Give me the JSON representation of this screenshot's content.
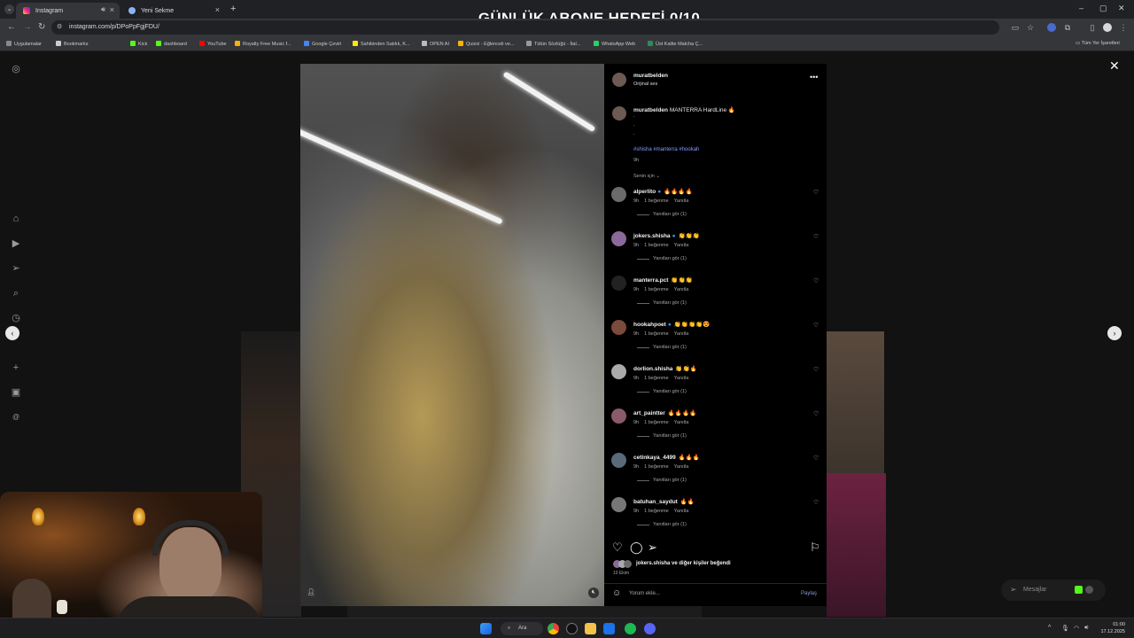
{
  "stream_overlay": {
    "title": "GÜNLÜK ABONE HEDEFİ 0/10"
  },
  "browser": {
    "tabs": [
      {
        "label": "Instagram",
        "active": true
      },
      {
        "label": "Yeni Sekme",
        "active": false
      }
    ],
    "new_tab_glyph": "+",
    "url": "instagram.com/p/DPoPpFgjFDU/",
    "bookmarks": [
      {
        "label": "Uygulamalar",
        "color": "#888888"
      },
      {
        "label": "Bookmarks",
        "color": "#cccccc"
      },
      {
        "label": "Kick",
        "color": "#53fc18"
      },
      {
        "label": "dashboard",
        "color": "#53fc18"
      },
      {
        "label": "YouTube",
        "color": "#ff0000"
      },
      {
        "label": "Royalty Free Music f...",
        "color": "#f4b400"
      },
      {
        "label": "Google Çeviri",
        "color": "#4285f4"
      },
      {
        "label": "Sahibinden Satılık, K...",
        "color": "#ffe800"
      },
      {
        "label": "OPEN AI",
        "color": "#bbbbbb"
      },
      {
        "label": "Quizxi - Eğlenceli ve...",
        "color": "#f4b400"
      },
      {
        "label": "Tütün Sözlüğü - İtal...",
        "color": "#999999"
      },
      {
        "label": "WhatsApp Web",
        "color": "#25d366"
      },
      {
        "label": "Üst Kalite Matcha Ç...",
        "color": "#2e8b57"
      }
    ],
    "all_bookmarks": "Tüm Yer İşaretleri"
  },
  "post": {
    "author": "muratbelden",
    "audio": "Orijinal ses",
    "caption_user": "muratbelden",
    "caption_text": "MANTERRA HardLine 🔥",
    "caption_dots": [
      ".",
      ".",
      "."
    ],
    "hashtags": "#shisha #manterra #hookah",
    "caption_time": "9h",
    "filter_label": "Senin için",
    "comments": [
      {
        "user": "alperlito",
        "verified": true,
        "text": "🔥🔥🔥🔥",
        "time": "9h",
        "likes": "1 beğenme",
        "reply": "Yanıtla",
        "view_replies": "Yanıtları gör (1)",
        "avatar_color": "#6b6b6b"
      },
      {
        "user": "jokers.shisha",
        "verified": true,
        "text": "👏👏👏",
        "time": "9h",
        "likes": "1 beğenme",
        "reply": "Yanıtla",
        "view_replies": "Yanıtları gör (1)",
        "avatar_color": "#8a6a9a"
      },
      {
        "user": "manterra.pct",
        "verified": false,
        "text": "👏👏👏",
        "time": "9h",
        "likes": "1 beğenme",
        "reply": "Yanıtla",
        "view_replies": "Yanıtları gör (1)",
        "avatar_color": "#222222"
      },
      {
        "user": "hookahpoet",
        "verified": true,
        "text": "👏👏👏👏😍",
        "time": "9h",
        "likes": "1 beğenme",
        "reply": "Yanıtla",
        "view_replies": "Yanıtları gör (1)",
        "avatar_color": "#7a4a3a"
      },
      {
        "user": "dorlion.shisha",
        "verified": false,
        "text": "👏👏🔥",
        "time": "9h",
        "likes": "1 beğenme",
        "reply": "Yanıtla",
        "view_replies": "Yanıtları gör (1)",
        "avatar_color": "#aaaaaa"
      },
      {
        "user": "art_paintter",
        "verified": false,
        "text": "🔥🔥🔥🔥",
        "time": "9h",
        "likes": "1 beğenme",
        "reply": "Yanıtla",
        "view_replies": "Yanıtları gör (1)",
        "avatar_color": "#8a5a6a"
      },
      {
        "user": "cetinkaya_4499",
        "verified": false,
        "text": "🔥🔥🔥",
        "time": "9h",
        "likes": "1 beğenme",
        "reply": "Yanıtla",
        "view_replies": "Yanıtları gör (1)",
        "avatar_color": "#5a6a7a"
      },
      {
        "user": "batuhan_saydut",
        "verified": false,
        "text": "🔥🔥",
        "time": "9h",
        "likes": "1 beğenme",
        "reply": "Yanıtla",
        "view_replies": "Yanıtları gör (1)",
        "avatar_color": "#777777"
      }
    ],
    "liked_by": "jokers.shisha ve diğer kişiler beğendi",
    "date": "10 Ekim",
    "comment_placeholder": "Yorum ekle...",
    "share_label": "Paylaş"
  },
  "messages_pill": {
    "label": "Mesajlar"
  },
  "taskbar": {
    "search_label": "Ara",
    "time": "01:00",
    "date": "17.12.2025"
  },
  "icons": {
    "close": "close-icon",
    "more": "more-options-icon",
    "like": "heart-icon",
    "comment": "comment-icon",
    "share": "share-icon",
    "save": "bookmark-icon"
  }
}
